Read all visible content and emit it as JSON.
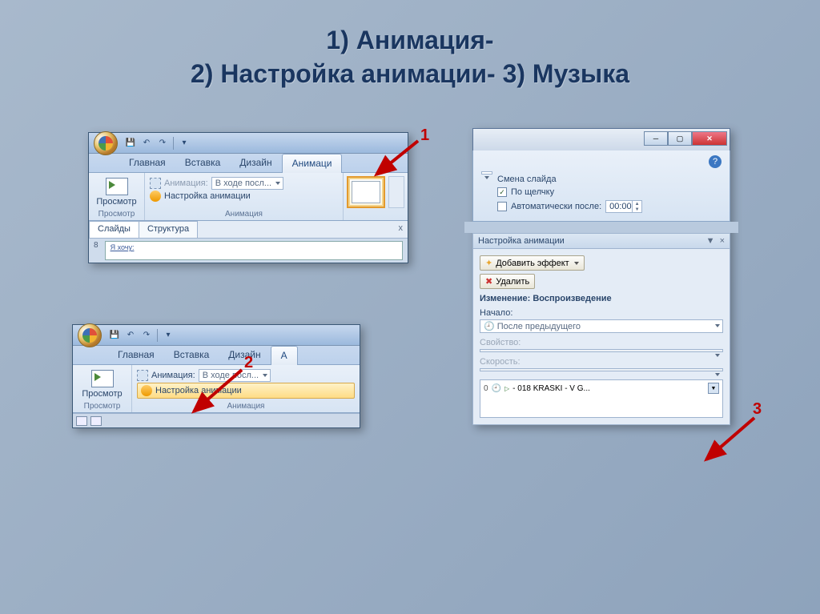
{
  "title_line1": "1) Анимация-",
  "title_line2": "2) Настройка анимации- 3) Музыка",
  "callouts": {
    "n1": "1",
    "n2": "2",
    "n3": "3"
  },
  "p1": {
    "tabs": {
      "home": "Главная",
      "insert": "Вставка",
      "design": "Дизайн",
      "anim": "Анимаци"
    },
    "preview_label": "Просмотр",
    "preview_group": "Просмотр",
    "anim_label": "Анимация:",
    "anim_value": "В ходе посл...",
    "settings_label": "Настройка анимации",
    "anim_group": "Анимация",
    "doc_tabs": {
      "slides": "Слайды",
      "structure": "Структура",
      "close": "x"
    },
    "slide_num": "8",
    "slide_text": "Я хочу:"
  },
  "p2": {
    "tabs": {
      "home": "Главная",
      "insert": "Вставка",
      "design": "Дизайн",
      "a": "А"
    },
    "preview_label": "Просмотр",
    "preview_group": "Просмотр",
    "anim_label": "Анимация:",
    "anim_value": "В ходе посл...",
    "settings_label": "Настройка анимации",
    "anim_group": "Анимация"
  },
  "p3": {
    "trans_title": "Смена слайда",
    "on_click": "По щелчку",
    "auto_after": "Автоматически после:",
    "auto_time": "00:00",
    "pane_title": "Настройка анимации",
    "add_effect": "Добавить эффект",
    "remove": "Удалить",
    "change_label": "Изменение: Воспроизведение",
    "start_label": "Начало:",
    "start_value": "После предыдущего",
    "property_label": "Свойство:",
    "speed_label": "Скорость:",
    "effect_num": "0",
    "effect_name": "- 018 KRASKI - V G..."
  }
}
